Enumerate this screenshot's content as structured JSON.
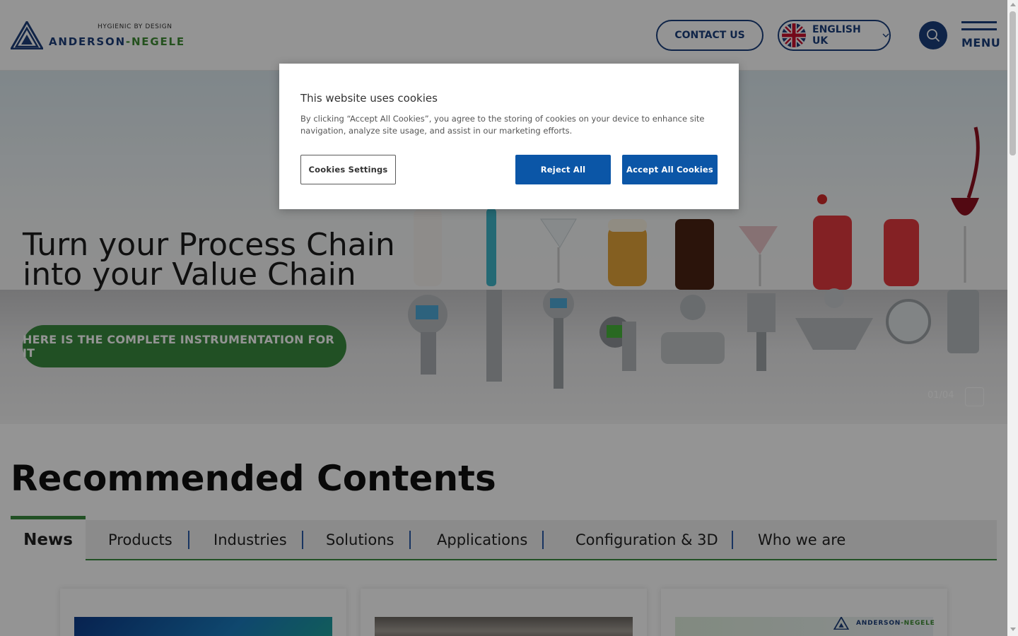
{
  "header": {
    "logo": {
      "tagline": "HYGIENIC BY DESIGN",
      "name_part1": "ANDERSON",
      "name_part2": "-NEGELE",
      "icon": "triangle-logo-icon"
    },
    "contact_label": "CONTACT US",
    "language_label": "ENGLISH UK",
    "language_flag_icon": "uk-flag-icon",
    "language_chevron_icon": "chevron-down-icon",
    "search_icon": "search-icon",
    "menu_label": "MENU",
    "menu_icon": "hamburger-icon"
  },
  "hero": {
    "title_line1": "Turn your Process Chain",
    "title_line2": "into your Value Chain",
    "cta_label": "HERE IS THE COMPLETE INSTRUMENTATION FOR IT",
    "slide_counter": "01/04",
    "pause_icon": "pause-icon"
  },
  "recommended": {
    "title": "Recommended Contents",
    "tabs": [
      "News",
      "Products",
      "Industries",
      "Solutions",
      "Applications",
      "Configuration & 3D",
      "Who we are"
    ],
    "active_tab": "News"
  },
  "cookie_banner": {
    "title": "This website uses cookies",
    "text": "By clicking “Accept All Cookies”, you agree to the storing of cookies on your device to enhance site navigation, analyze site usage, and assist in our marketing efforts.",
    "settings_label": "Cookies Settings",
    "reject_label": "Reject All",
    "accept_label": "Accept All Cookies"
  },
  "colors": {
    "brand_blue": "#1b3f7c",
    "brand_green": "#3a8a3e",
    "cookie_button_blue": "#0b56a7"
  }
}
